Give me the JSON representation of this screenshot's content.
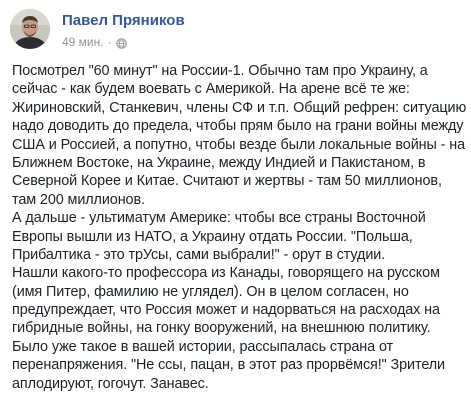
{
  "post": {
    "author": "Павел Пряников",
    "timestamp": "49 мин.",
    "separator": "·",
    "audience_icon": "globe-icon",
    "lines": [
      "Посмотрел \"60 минут\" на России-1. Обычно там про Украину, а",
      "сейчас - как будем воевать с Америкой. На арене всё те же:",
      "Жириновский, Станкевич, члены СФ и т.п. Общий рефрен: ситуацию",
      "надо доводить до предела, чтобы прям было на грани войны между",
      "США и Россией, а попутно, чтобы везде были локальные войны - на",
      "Ближнем Востоке, на Украине, между Индией и Пакистаном, в",
      "Северной Корее и Китае. Считают и жертвы - там 50 миллионов,",
      "там 200 миллионов.",
      "А дальше - ультиматум Америке: чтобы все страны Восточной",
      "Европы вышли из НАТО, а Украину отдать России. \"Польша,",
      "Прибалтика - это трУсы, сами выбрали!\" - орут в студии.",
      "Нашли какого-то профессора из Канады, говорящего на русском",
      "(имя Питер, фамилию не углядел). Он в целом согласен, но",
      "предупреждает, что Россия может и надорваться на расходах на",
      "гибридные войны, на гонку вооружений, на внешнюю политику.",
      "Было уже такое в вашей истории, рассыпалась страна от",
      "перенапряжения. \"Не ссы, пацан, в этот раз прорвёмся!\" Зрители",
      "аплодируют, гогочут. Занавес."
    ]
  },
  "colors": {
    "author_link": "#365899",
    "meta_text": "#90949c",
    "body_text": "#1d2129",
    "background": "#ffffff"
  }
}
